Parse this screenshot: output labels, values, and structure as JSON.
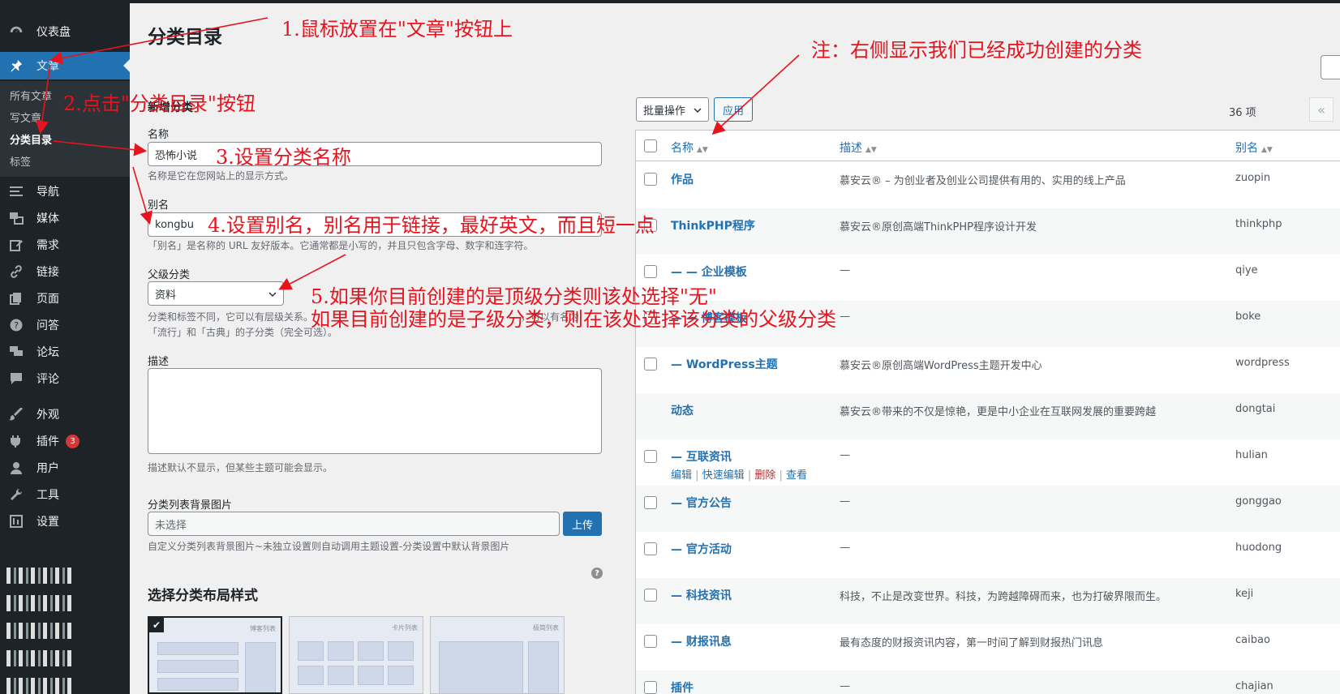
{
  "sidebar": {
    "items": [
      {
        "label": "仪表盘",
        "icon": "dashboard-icon"
      },
      {
        "label": "文章",
        "icon": "pin-icon",
        "active": true
      },
      {
        "label": "导航",
        "icon": "menu-icon"
      },
      {
        "label": "媒体",
        "icon": "media-icon"
      },
      {
        "label": "需求",
        "icon": "edit-icon"
      },
      {
        "label": "链接",
        "icon": "link-icon"
      },
      {
        "label": "页面",
        "icon": "page-icon"
      },
      {
        "label": "问答",
        "icon": "question-icon"
      },
      {
        "label": "论坛",
        "icon": "forum-icon"
      },
      {
        "label": "评论",
        "icon": "comment-icon"
      },
      {
        "label": "外观",
        "icon": "brush-icon"
      },
      {
        "label": "插件",
        "icon": "plugin-icon",
        "badge": "3"
      },
      {
        "label": "用户",
        "icon": "user-icon"
      },
      {
        "label": "工具",
        "icon": "wrench-icon"
      },
      {
        "label": "设置",
        "icon": "settings-icon"
      }
    ],
    "submenu": [
      "所有文章",
      "写文章",
      "分类目录",
      "标签"
    ]
  },
  "page": {
    "title": "分类目录",
    "form_heading": "新增分类",
    "name_label": "名称",
    "name_value": "恐怖小说",
    "name_help": "名称是它在您网站上的显示方式。",
    "slug_label": "别名",
    "slug_value": "kongbu",
    "slug_help": "「别名」是名称的 URL 友好版本。它通常都是小写的，并且只包含字母、数字和连字符。",
    "parent_label": "父级分类",
    "parent_value": "资料",
    "parent_help_1": "分类和标签不同，它可以有层级关系。",
    "parent_help_1b": "，可以有名为",
    "parent_help_2": "「流行」和「古典」的子分类（完全可选）。",
    "desc_label": "描述",
    "desc_help": "描述默认不显示，但某些主题可能会显示。",
    "bg_label": "分类列表背景图片",
    "bg_value": "未选择",
    "upload_label": "上传",
    "bg_help": "自定义分类列表背景图片~未独立设置则自动调用主题设置-分类设置中默认背景图片",
    "layout_heading": "选择分类布局样式",
    "layouts": [
      "博客列表",
      "卡片列表",
      "极简列表"
    ]
  },
  "table": {
    "bulk_label": "批量操作",
    "apply_label": "应用",
    "count": "36 项",
    "pager_prev": "«",
    "headers": {
      "name": "名称",
      "desc": "描述",
      "slug": "别名"
    },
    "rows": [
      {
        "name": "作品",
        "desc": "慕安云® – 为创业者及创业公司提供有用的、实用的线上产品",
        "slug": "zuopin"
      },
      {
        "name": "ThinkPHP程序",
        "desc": "慕安云®原创高端ThinkPHP程序设计开发",
        "slug": "thinkphp"
      },
      {
        "name": "— — 企业模板",
        "desc": "—",
        "slug": "qiye"
      },
      {
        "name": "— — 博客模板",
        "desc": "—",
        "slug": "boke"
      },
      {
        "name": "— WordPress主题",
        "desc": "慕安云®原创高端WordPress主题开发中心",
        "slug": "wordpress"
      },
      {
        "name": "动态",
        "desc": "慕安云®带来的不仅是惊艳，更是中小企业在互联网发展的重要跨越",
        "slug": "dongtai"
      },
      {
        "name": "— 互联资讯",
        "desc": "—",
        "slug": "hulian"
      },
      {
        "name": "— 官方公告",
        "desc": "—",
        "slug": "gonggao"
      },
      {
        "name": "— 官方活动",
        "desc": "—",
        "slug": "huodong"
      },
      {
        "name": "— 科技资讯",
        "desc": "科技，不止是改变世界。科技，为跨越障碍而来，也为打破界限而生。",
        "slug": "keji"
      },
      {
        "name": "— 财报讯息",
        "desc": "最有态度的财报资讯内容，第一时间了解到财报热门讯息",
        "slug": "caibao"
      },
      {
        "name": "插件",
        "desc": "—",
        "slug": "chajian"
      }
    ],
    "row_actions": {
      "edit": "编辑",
      "quick_edit": "快速编辑",
      "delete": "删除",
      "view": "查看"
    }
  },
  "annotations": {
    "a1": "1.鼠标放置在\"文章\"按钮上",
    "a2": "2.点击\"分类目录\"按钮",
    "a3": "3.设置分类名称",
    "a4": "4.设置别名，别名用于链接，最好英文，而且短一点",
    "a5": "5.如果你目前创建的是顶级分类则该处选择\"无\"",
    "a5b": "如果目前创建的是子级分类，则在该处选择该分类的父级分类",
    "note": "注：右侧显示我们已经成功创建的分类"
  },
  "colors": {
    "accent": "#2271b1",
    "annotation": "#e8131d",
    "sidebar": "#1d2327"
  }
}
